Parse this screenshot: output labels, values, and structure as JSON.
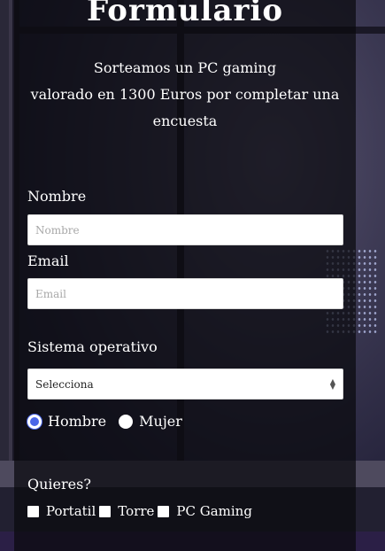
{
  "form": {
    "title": "Formulario",
    "subtitle_lines": [
      "Sorteamos un PC gaming",
      "valorado en 1300 Euros por completar una",
      "encuesta"
    ],
    "name": {
      "label": "Nombre",
      "placeholder": "Nombre",
      "value": ""
    },
    "email": {
      "label": "Email",
      "placeholder": "Email",
      "value": ""
    },
    "os": {
      "label": "Sistema operativo",
      "selected": "Selecciona"
    },
    "gender": {
      "options": [
        {
          "label": "Hombre",
          "checked": true
        },
        {
          "label": "Mujer",
          "checked": false
        }
      ]
    },
    "wants": {
      "label": "Quieres?",
      "options": [
        {
          "label": "Portatil",
          "checked": false
        },
        {
          "label": "Torre",
          "checked": false
        },
        {
          "label": "PC Gaming",
          "checked": false
        }
      ]
    }
  },
  "colors": {
    "radio_accent": "#4a66e8",
    "overlay": "rgba(10,10,14,0.72)",
    "text": "#ffffff"
  }
}
